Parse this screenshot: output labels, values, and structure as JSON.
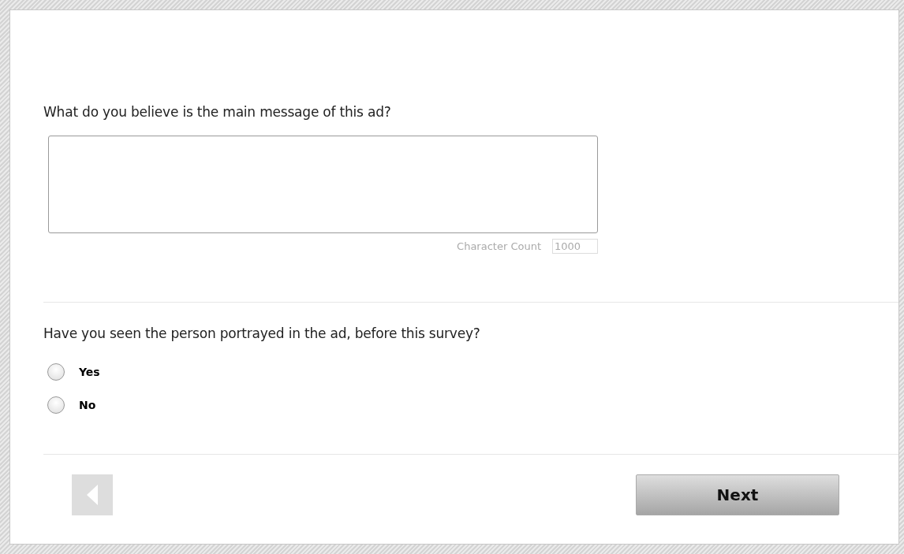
{
  "questions": [
    {
      "kind": "text",
      "prompt": "What do you believe is the main message of this ad?",
      "character_count_label": "Character Count",
      "character_count": "1000"
    },
    {
      "kind": "choice",
      "prompt": "Have you seen the person portrayed in the ad, before this survey?",
      "options": [
        {
          "label": "Yes",
          "selected": false
        },
        {
          "label": "No",
          "selected": false
        }
      ]
    }
  ],
  "navigation": {
    "back_disabled": true,
    "next_label": "Next"
  }
}
